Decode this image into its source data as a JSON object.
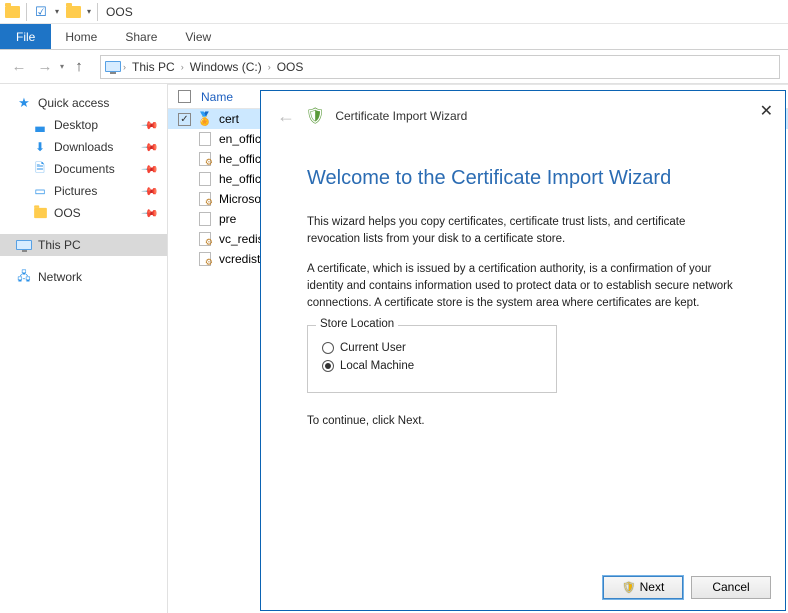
{
  "window": {
    "title": "OOS"
  },
  "ribbon": {
    "file": "File",
    "home": "Home",
    "share": "Share",
    "view": "View"
  },
  "breadcrumb": {
    "root": "This PC",
    "drive": "Windows (C:)",
    "folder": "OOS"
  },
  "navpane": {
    "quick_access": "Quick access",
    "desktop": "Desktop",
    "downloads": "Downloads",
    "documents": "Documents",
    "pictures": "Pictures",
    "oos": "OOS",
    "this_pc": "This PC",
    "network": "Network"
  },
  "columns": {
    "name": "Name"
  },
  "files": {
    "cert": "cert",
    "en_office": "en_office",
    "he_office_cf": "he_office",
    "he_office": "he_office",
    "microsoft": "Microsoft",
    "pre": "pre",
    "vc_redist": "vc_redist",
    "vcredist": "vcredist_"
  },
  "wizard": {
    "header": "Certificate Import Wizard",
    "heading": "Welcome to the Certificate Import Wizard",
    "para1": "This wizard helps you copy certificates, certificate trust lists, and certificate revocation lists from your disk to a certificate store.",
    "para2": "A certificate, which is issued by a certification authority, is a confirmation of your identity and contains information used to protect data or to establish secure network connections. A certificate store is the system area where certificates are kept.",
    "store_legend": "Store Location",
    "current_user": "Current User",
    "local_machine": "Local Machine",
    "continue": "To continue, click Next.",
    "next": "Next",
    "cancel": "Cancel"
  }
}
